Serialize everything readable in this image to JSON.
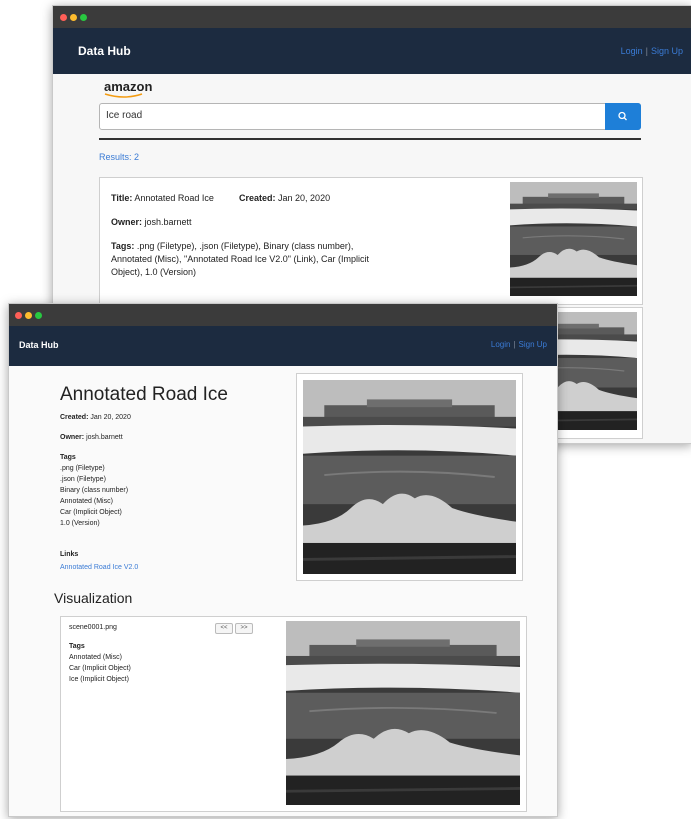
{
  "brand": "Data Hub",
  "auth": {
    "login": "Login",
    "separator": "|",
    "signup": "Sign Up"
  },
  "search_page": {
    "logo": "amazon",
    "search_value": "Ice road",
    "results_label": "Results: 2",
    "result": {
      "title_label": "Title:",
      "title": "Annotated Road Ice",
      "created_label": "Created:",
      "created": "Jan 20, 2020",
      "owner_label": "Owner:",
      "owner": "josh.barnett",
      "tags_label": "Tags:",
      "tags_lines": [
        ".png (Filetype), .json (Filetype), Binary (class number),",
        "Annotated (Misc), \"Annotated Road Ice V2.0\" (Link), Car (Implicit",
        "Object), 1.0 (Version)"
      ]
    }
  },
  "detail_page": {
    "title": "Annotated Road Ice",
    "created_label": "Created:",
    "created": "Jan 20, 2020",
    "owner_label": "Owner:",
    "owner": "josh.barnett",
    "tags_heading": "Tags",
    "tags": [
      ".png (Filetype)",
      ".json (Filetype)",
      "Binary (class number)",
      "Annotated (Misc)",
      "Car (Implicit Object)",
      "1.0 (Version)"
    ],
    "links_heading": "Links",
    "link": "Annotated Road Ice V2.0",
    "visualization_heading": "Visualization",
    "viz": {
      "filename": "scene0001.png",
      "prev": "<<",
      "next": ">>",
      "tags_heading": "Tags",
      "tags": [
        "Annotated (Misc)",
        "Car (Implicit Object)",
        "Ice (Implicit Object)"
      ]
    }
  },
  "colors": {
    "navbar": "#1c2b40",
    "link": "#3a7bd5",
    "search_button": "#1e7fd8",
    "dot_red": "#ff5f57",
    "dot_yellow": "#febc2e",
    "dot_green": "#28c840"
  },
  "icons": [
    "search-icon",
    "window-close-dot",
    "window-minimize-dot",
    "window-zoom-dot"
  ]
}
